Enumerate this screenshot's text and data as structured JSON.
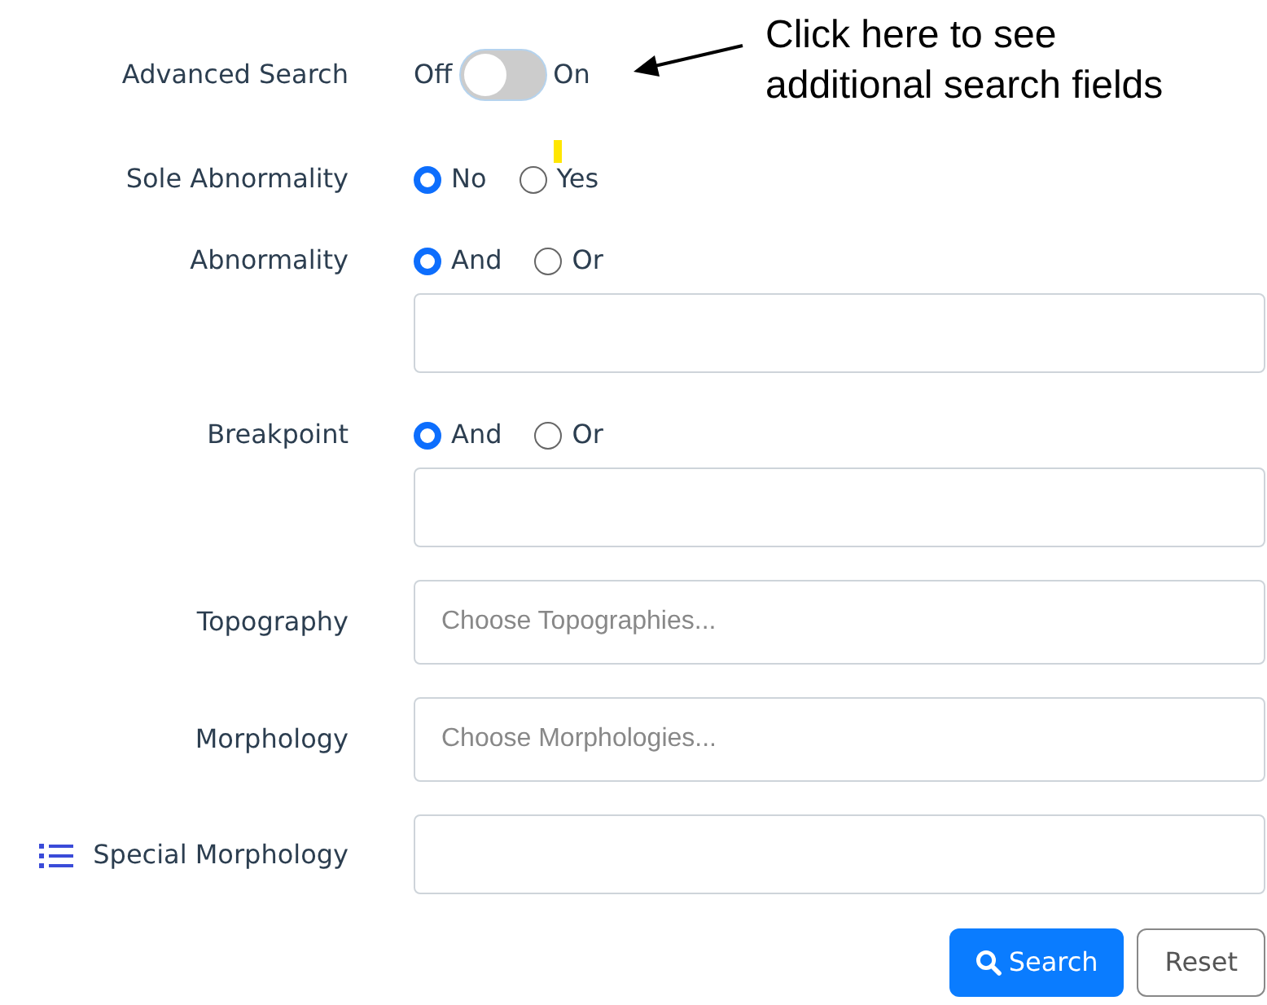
{
  "annotation": {
    "lines": [
      "Click here to see",
      "additional search fields"
    ]
  },
  "rows": [
    {
      "kind": "toggle",
      "label": "Advanced Search",
      "off_text": "Off",
      "on_text": "On",
      "on": false
    },
    {
      "kind": "radio",
      "label": "Sole Abnormality",
      "options": [
        {
          "label": "No",
          "selected": true
        },
        {
          "label": "Yes",
          "selected": false,
          "highlight": true
        }
      ]
    },
    {
      "kind": "radio-input",
      "label": "Abnormality",
      "options": [
        {
          "label": "And",
          "selected": true
        },
        {
          "label": "Or",
          "selected": false
        }
      ]
    },
    {
      "kind": "radio-input",
      "label": "Breakpoint",
      "options": [
        {
          "label": "And",
          "selected": true
        },
        {
          "label": "Or",
          "selected": false
        }
      ]
    },
    {
      "kind": "select",
      "label": "Topography",
      "placeholder": "Choose Topographies..."
    },
    {
      "kind": "select",
      "label": "Morphology",
      "placeholder": "Choose Morphologies..."
    },
    {
      "kind": "input",
      "label": "Special Morphology"
    }
  ],
  "buttons": [
    {
      "kind": "primary",
      "label": "Search"
    },
    {
      "kind": "secondary",
      "label": "Reset"
    }
  ]
}
